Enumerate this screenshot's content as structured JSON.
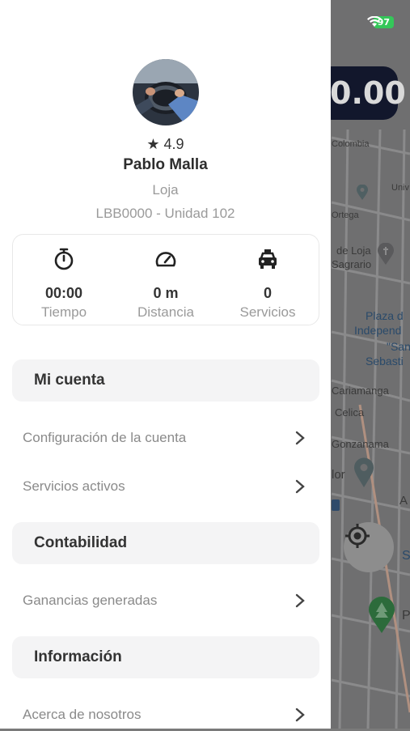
{
  "status_bar": {
    "battery": "97"
  },
  "map": {
    "fare_text": "0.00",
    "labels": [
      "Colombia",
      "Univ",
      "Ortega",
      "de Loja",
      "Sagrario",
      "Plaza d",
      "Independ",
      "\"San",
      "Sebasti",
      "Cariamanga",
      "Celica",
      "Gonzanama",
      "lor",
      "A",
      "S",
      "P"
    ]
  },
  "profile": {
    "rating": "★ 4.9",
    "name": "Pablo Malla",
    "city": "Loja",
    "unit": "LBB0000 - Unidad 102"
  },
  "stats": [
    {
      "icon": "stopwatch-icon",
      "value": "00:00",
      "label": "Tiempo"
    },
    {
      "icon": "speedometer-icon",
      "value": "0 m",
      "label": "Distancia"
    },
    {
      "icon": "taxi-icon",
      "value": "0",
      "label": "Servicios"
    }
  ],
  "menu": {
    "mi_cuenta": {
      "title": "Mi cuenta",
      "items": [
        "Configuración de la cuenta",
        "Servicios activos"
      ]
    },
    "contabilidad": {
      "title": "Contabilidad",
      "items": [
        "Ganancias generadas"
      ]
    },
    "informacion": {
      "title": "Información",
      "items": [
        "Acerca de nosotros"
      ]
    }
  },
  "colors": {
    "battery": "#34c759",
    "fare_pill": "#12172c",
    "section_bg": "#f4f4f5"
  }
}
